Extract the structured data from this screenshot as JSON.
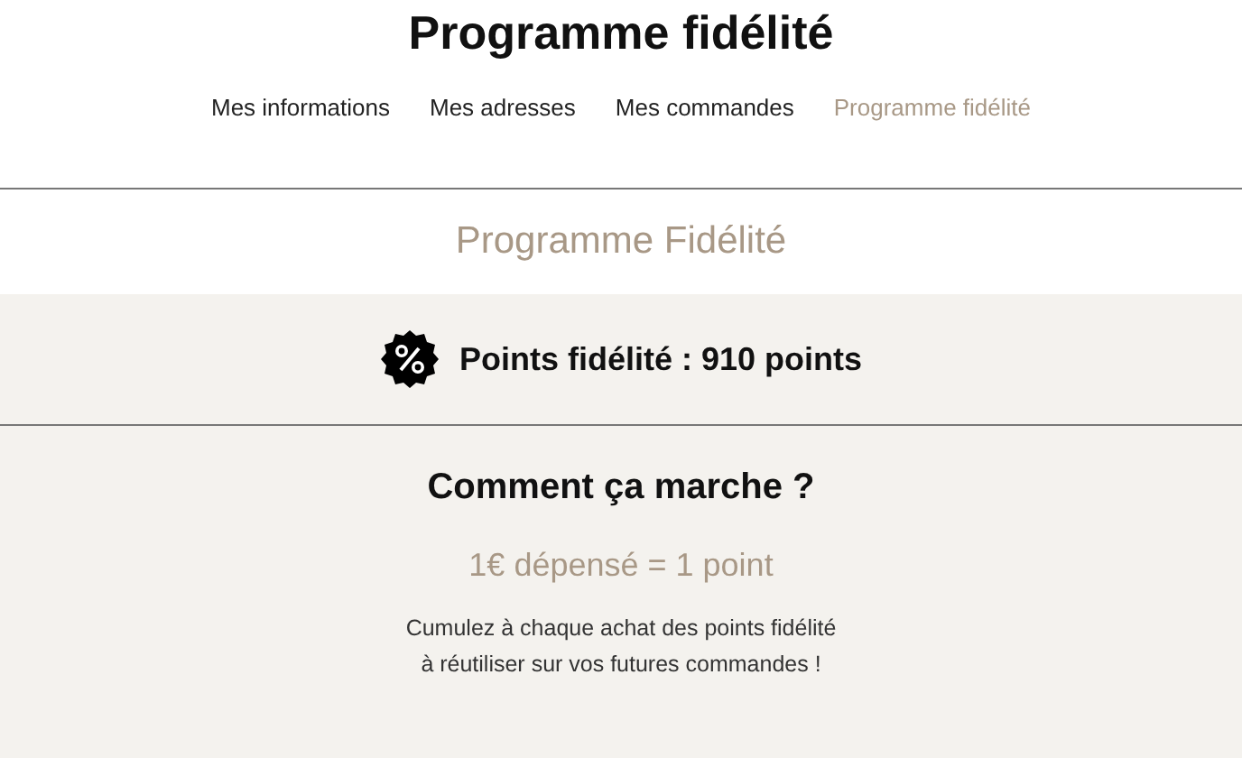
{
  "page_title": "Programme fidélité",
  "nav": [
    {
      "label": "Mes informations",
      "selected": false
    },
    {
      "label": "Mes adresses",
      "selected": false
    },
    {
      "label": "Mes commandes",
      "selected": false
    },
    {
      "label": "Programme fidélité",
      "selected": true
    }
  ],
  "section_title": "Programme Fidélité",
  "points": "Points fidélité : 910 points",
  "how": {
    "title": "Comment ça marche ?",
    "rate": "1€ dépensé = 1 point",
    "text": "Cumulez à chaque achat des points fidélité\nà réutiliser sur vos futures commandes !"
  }
}
